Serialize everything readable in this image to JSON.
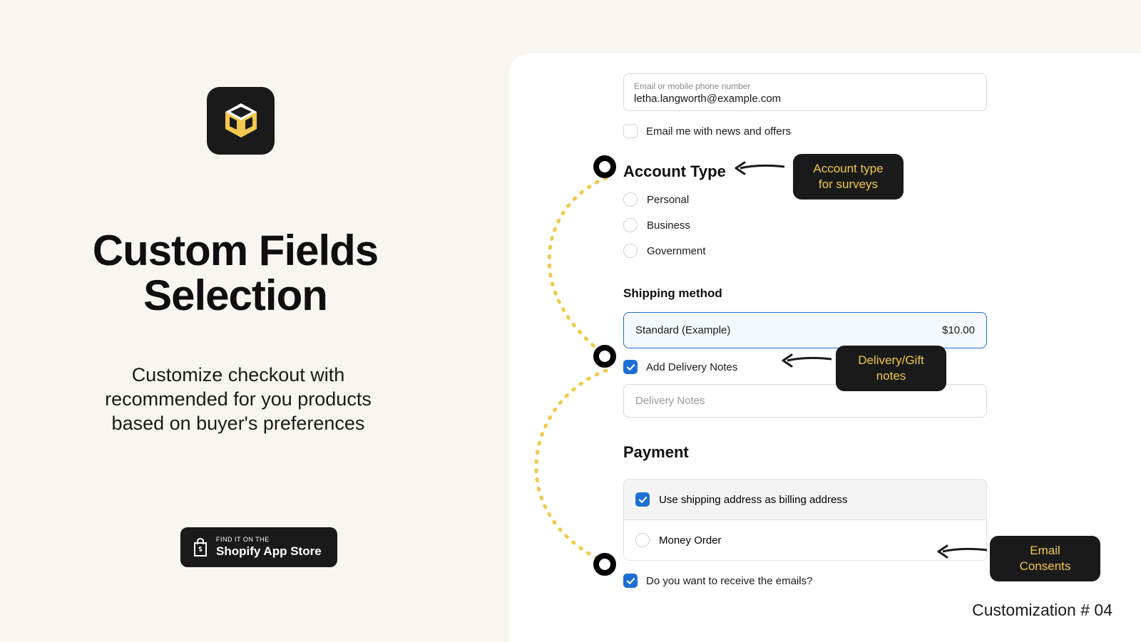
{
  "left": {
    "title": "Custom Fields Selection",
    "subtitle": "Customize checkout with recommended for you products based on buyer's preferences",
    "store_line1": "FIND IT ON THE",
    "store_line2": "Shopify App Store"
  },
  "form": {
    "contact_label": "Email or mobile phone number",
    "contact_value": "letha.langworth@example.com",
    "newsletter_label": "Email me with news and offers",
    "account_type_head": "Account Type",
    "account_options": {
      "personal": "Personal",
      "business": "Business",
      "government": "Government"
    },
    "shipping_head": "Shipping method",
    "shipping_name": "Standard (Example)",
    "shipping_price": "$10.00",
    "delivery_checkbox": "Add Delivery Notes",
    "delivery_placeholder": "Delivery Notes",
    "payment_head": "Payment",
    "use_shipping": "Use shipping address as billing address",
    "money_order": "Money Order",
    "email_consent": "Do you want to receive the emails?"
  },
  "callouts": {
    "account": "Account type for surveys",
    "delivery": "Delivery/Gift notes",
    "email": "Email Consents"
  },
  "footer": "Customization # 04"
}
